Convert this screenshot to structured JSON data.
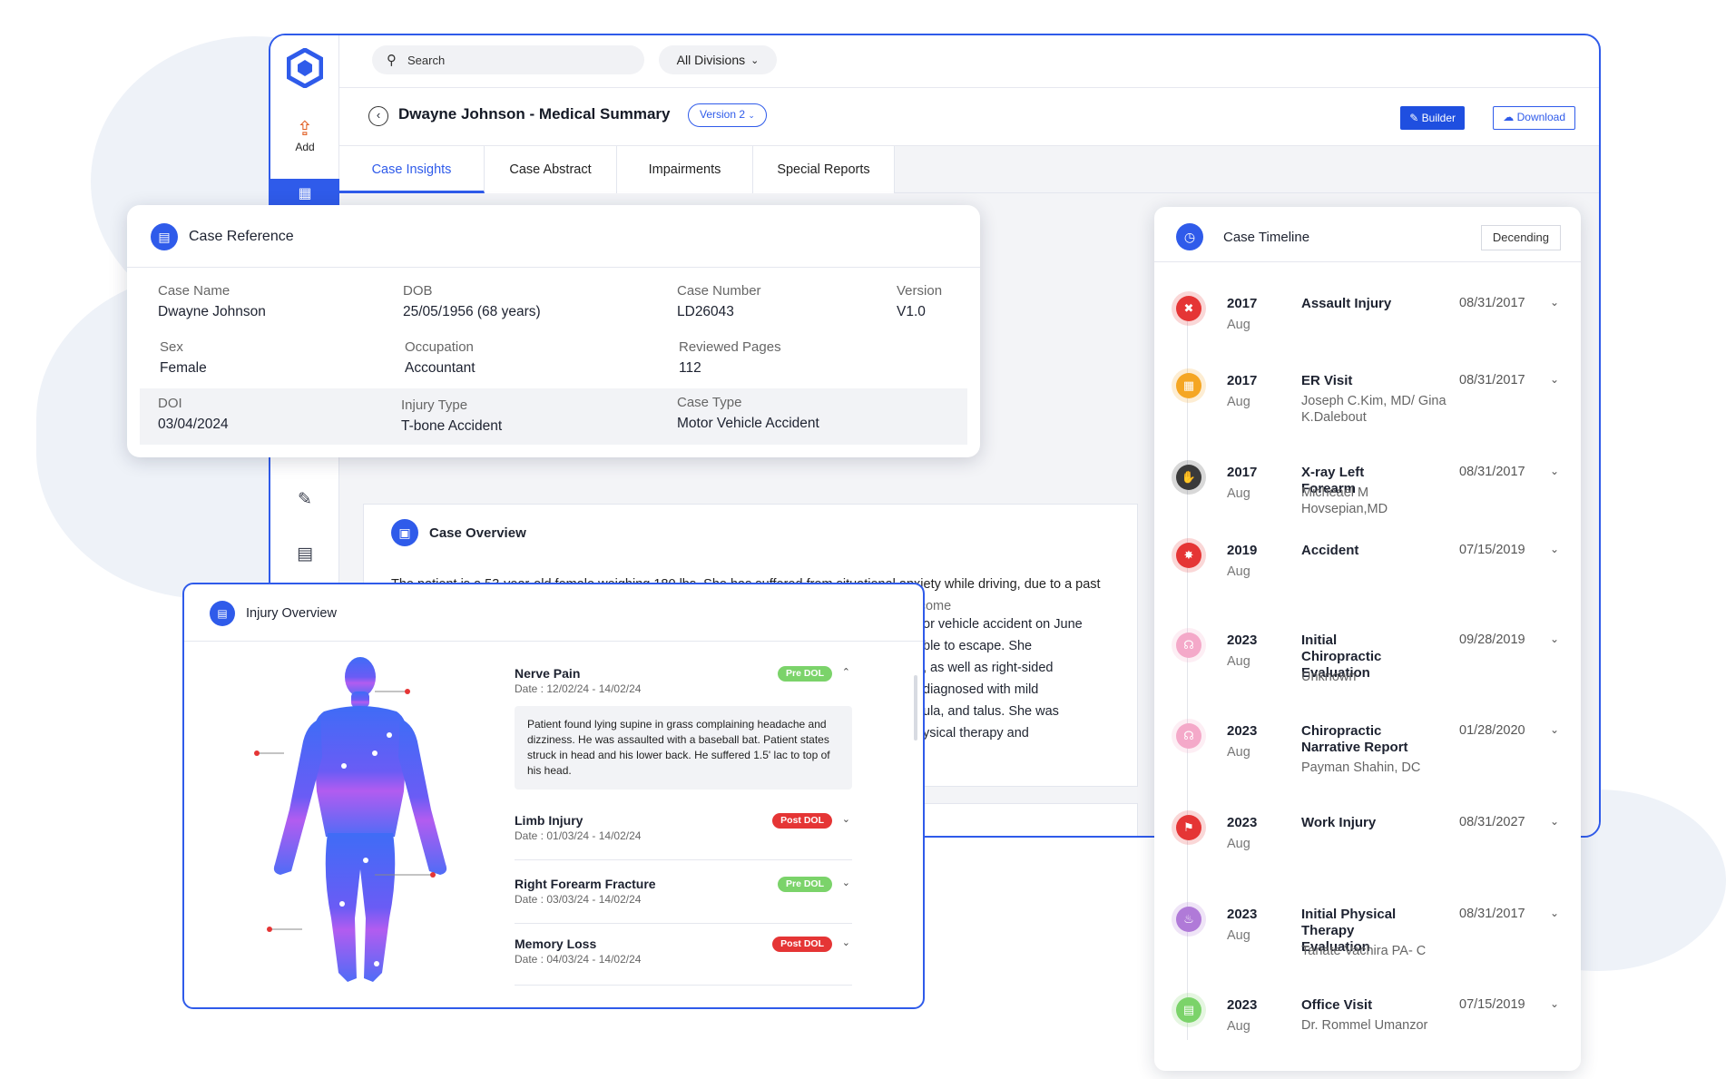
{
  "app": {
    "search_placeholder": "Search",
    "division": "All Divisions",
    "rail_add": "Add"
  },
  "header": {
    "title": "Dwayne Johnson - Medical Summary",
    "version": "Version 2",
    "builder": "Builder",
    "download": "Download"
  },
  "tabs": [
    "Case Insights",
    "Case Abstract",
    "Impairments",
    "Special Reports"
  ],
  "case_reference": {
    "title": "Case Reference",
    "fields": {
      "case_name": {
        "label": "Case Name",
        "value": "Dwayne Johnson"
      },
      "dob": {
        "label": "DOB",
        "value": "25/05/1956  (68 years)"
      },
      "case_number": {
        "label": "Case Number",
        "value": "LD26043"
      },
      "version": {
        "label": "Version",
        "value": "V1.0"
      },
      "sex": {
        "label": "Sex",
        "value": "Female"
      },
      "occupation": {
        "label": "Occupation",
        "value": "Accountant"
      },
      "reviewed_pages": {
        "label": "Reviewed Pages",
        "value": "112"
      },
      "doi": {
        "label": "DOI",
        "value": "03/04/2024"
      },
      "injury_type": {
        "label": "Injury Type",
        "value": "T-bone Accident"
      },
      "case_type": {
        "label": "Case Type",
        "value": "Motor Vehicle Accident"
      }
    }
  },
  "case_overview": {
    "title": "Case Overview",
    "text": "The patient is a 53-year-old female weighing 180 lbs. She has suffered from situational anxiety while driving, due to a past accident. She felt flushed, shaky, and had a racing heartbeat and her anxiety symptoms become",
    "fragments": [
      "or vehicle accident on June",
      "ble to escape. She",
      ", as well as right-sided",
      "diagnosed with mild",
      "ula, and talus. She was",
      "ysical therapy and"
    ]
  },
  "timeline": {
    "title": "Case Timeline",
    "sort": "Decending",
    "items": [
      {
        "year": "2017",
        "month": "Aug",
        "title": "Assault Injury",
        "sub": "",
        "date": "08/31/2017",
        "color": "#e53535",
        "icon": "assault-icon"
      },
      {
        "year": "2017",
        "month": "Aug",
        "title": "ER Visit",
        "sub": "Joseph C.Kim, MD/ Gina K.Dalebout",
        "date": "08/31/2017",
        "color": "#f5a623",
        "icon": "hospital-icon"
      },
      {
        "year": "2017",
        "month": "Aug",
        "title": "X-ray Left Forearm",
        "sub": "Micheael M Hovsepian,MD",
        "date": "08/31/2017",
        "color": "#3a3a3a",
        "icon": "xray-hand-icon"
      },
      {
        "year": "2019",
        "month": "Aug",
        "title": "Accident",
        "sub": "",
        "date": "07/15/2019",
        "color": "#e53535",
        "icon": "car-crash-icon"
      },
      {
        "year": "2023",
        "month": "Aug",
        "title": "Initial Chiropractic Evaluation",
        "sub": "Unknown",
        "date": "09/28/2019",
        "color": "#f4a9c9",
        "icon": "chiropractic-icon"
      },
      {
        "year": "2023",
        "month": "Aug",
        "title": "Chiropractic Narrative Report",
        "sub": "Payman Shahin, DC",
        "date": "01/28/2020",
        "color": "#f4a9c9",
        "icon": "chiropractic-icon"
      },
      {
        "year": "2023",
        "month": "Aug",
        "title": "Work Injury",
        "sub": "",
        "date": "08/31/2027",
        "color": "#e53535",
        "icon": "work-injury-icon"
      },
      {
        "year": "2023",
        "month": "Aug",
        "title": "Initial Physical Therapy Evaluation",
        "sub": "Tanate Vachira PA- C",
        "date": "08/31/2017",
        "color": "#b07ad8",
        "icon": "physical-therapy-icon"
      },
      {
        "year": "2023",
        "month": "Aug",
        "title": "Office Visit",
        "sub": "Dr. Rommel Umanzor",
        "date": "07/15/2019",
        "color": "#7bd36a",
        "icon": "clipboard-icon"
      }
    ]
  },
  "injury": {
    "title": "Injury Overview",
    "items": [
      {
        "name": "Nerve Pain",
        "date": "Date : 12/02/24 - 14/02/24",
        "badge": "Pre DOL",
        "desc": "Patient found lying supine in grass complaining headache and dizziness. He was assaulted with a baseball bat. Patient states struck in head and his lower back. He suffered 1.5' lac to top of his head."
      },
      {
        "name": "Limb Injury",
        "date": "Date : 01/03/24 - 14/02/24",
        "badge": "Post DOL"
      },
      {
        "name": "Right Forearm Fracture",
        "date": "Date : 03/03/24 - 14/02/24",
        "badge": "Pre DOL"
      },
      {
        "name": "Memory Loss",
        "date": "Date : 04/03/24 - 14/02/24",
        "badge": "Post DOL"
      }
    ]
  }
}
